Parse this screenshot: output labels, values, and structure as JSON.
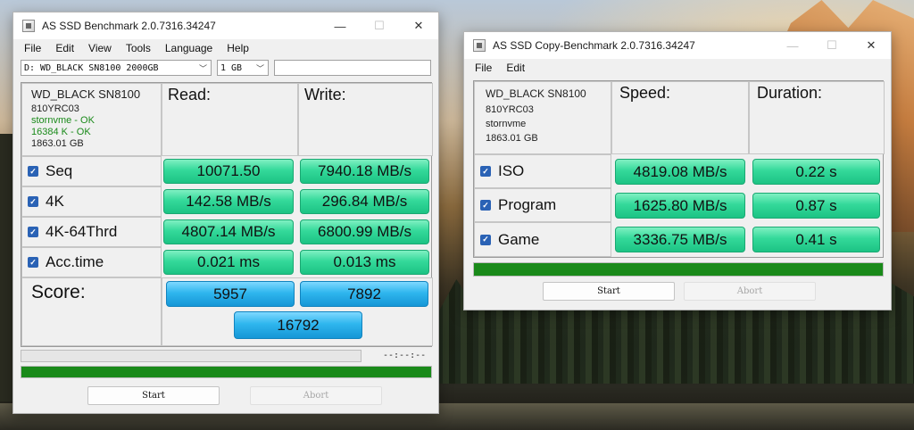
{
  "main_window": {
    "title": "AS SSD Benchmark 2.0.7316.34247",
    "controls": {
      "minimize": "—",
      "maximize": "☐",
      "close": "✕"
    },
    "menu": [
      "File",
      "Edit",
      "View",
      "Tools",
      "Language",
      "Help"
    ],
    "drive_select": "D: WD_BLACK SN8100 2000GB",
    "size_select": "1 GB",
    "drive_info": {
      "model": "WD_BLACK SN8100",
      "firmware": "810YRC03",
      "driver": "stornvme - OK",
      "alignment": "16384 K - OK",
      "capacity": "1863.01 GB"
    },
    "headers": {
      "read": "Read:",
      "write": "Write:"
    },
    "rows": [
      {
        "label": "Seq",
        "read": "10071.50",
        "write": "7940.18 MB/s"
      },
      {
        "label": "4K",
        "read": "142.58 MB/s",
        "write": "296.84 MB/s"
      },
      {
        "label": "4K-64Thrd",
        "read": "4807.14 MB/s",
        "write": "6800.99 MB/s"
      },
      {
        "label": "Acc.time",
        "read": "0.021 ms",
        "write": "0.013 ms"
      }
    ],
    "score_label": "Score:",
    "score": {
      "read": "5957",
      "write": "7892",
      "total": "16792"
    },
    "time_label": "--:--:--",
    "progress_percent": 100,
    "buttons": {
      "start": "Start",
      "abort": "Abort"
    }
  },
  "copy_window": {
    "title": "AS SSD Copy-Benchmark 2.0.7316.34247",
    "controls": {
      "minimize": "—",
      "maximize": "☐",
      "close": "✕"
    },
    "menu": [
      "File",
      "Edit"
    ],
    "drive_info": {
      "model": "WD_BLACK SN8100",
      "firmware": "810YRC03",
      "driver": "stornvme",
      "capacity": "1863.01 GB"
    },
    "headers": {
      "speed": "Speed:",
      "duration": "Duration:"
    },
    "rows": [
      {
        "label": "ISO",
        "speed": "4819.08 MB/s",
        "duration": "0.22 s"
      },
      {
        "label": "Program",
        "speed": "1625.80 MB/s",
        "duration": "0.87 s"
      },
      {
        "label": "Game",
        "speed": "3336.75 MB/s",
        "duration": "0.41 s"
      }
    ],
    "progress_percent": 100,
    "buttons": {
      "start": "Start",
      "abort": "Abort"
    }
  },
  "colors": {
    "result_green": "#34d99a",
    "score_blue": "#2fb6ee",
    "progress_green": "#1a8a1a",
    "ok_text": "#1a8a1a",
    "checkbox_blue": "#2a62b5"
  },
  "icons": {
    "checkbox": "checkbox-checked-icon",
    "dropdown": "chevron-down-icon",
    "app": "app-icon"
  }
}
